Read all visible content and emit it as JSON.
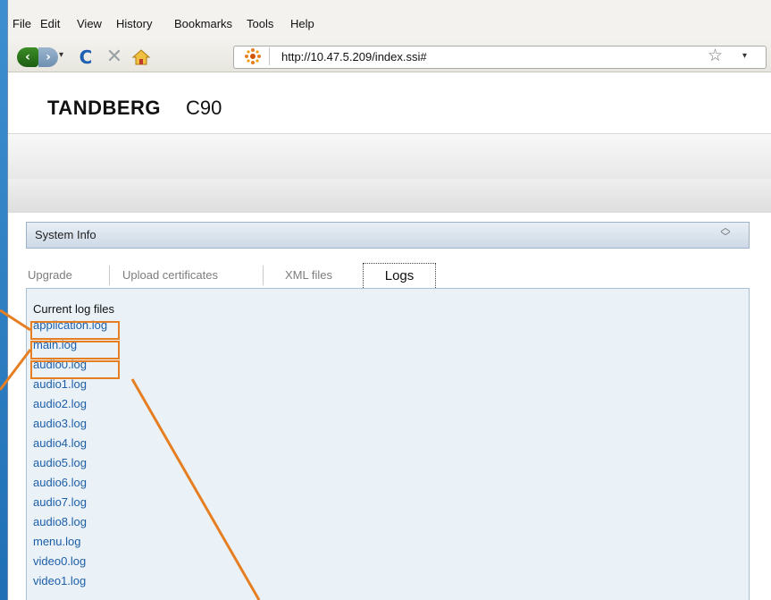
{
  "menu": {
    "items": [
      "File",
      "Edit",
      "View",
      "History",
      "Bookmarks",
      "Tools",
      "Help"
    ]
  },
  "navbar": {
    "url": "http://10.47.5.209/index.ssi#"
  },
  "brand": {
    "name": "TANDBERG",
    "model": "C90"
  },
  "section": {
    "title": "System Info"
  },
  "tabs": [
    {
      "label": "Upgrade",
      "active": false
    },
    {
      "label": "Upload certificates",
      "active": false
    },
    {
      "label": "XML files",
      "active": false
    },
    {
      "label": "Logs",
      "active": true
    }
  ],
  "logs_panel": {
    "title": "Current log files",
    "files": [
      "application.log",
      "main.log",
      "audio0.log",
      "audio1.log",
      "audio2.log",
      "audio3.log",
      "audio4.log",
      "audio5.log",
      "audio6.log",
      "audio7.log",
      "audio8.log",
      "menu.log",
      "video0.log",
      "video1.log"
    ],
    "highlighted_files": [
      "application.log",
      "main.log",
      "audio0.log"
    ]
  },
  "colors": {
    "highlight": "#e67e22",
    "link": "#1d5ea8",
    "background": "#1a6fb8"
  }
}
